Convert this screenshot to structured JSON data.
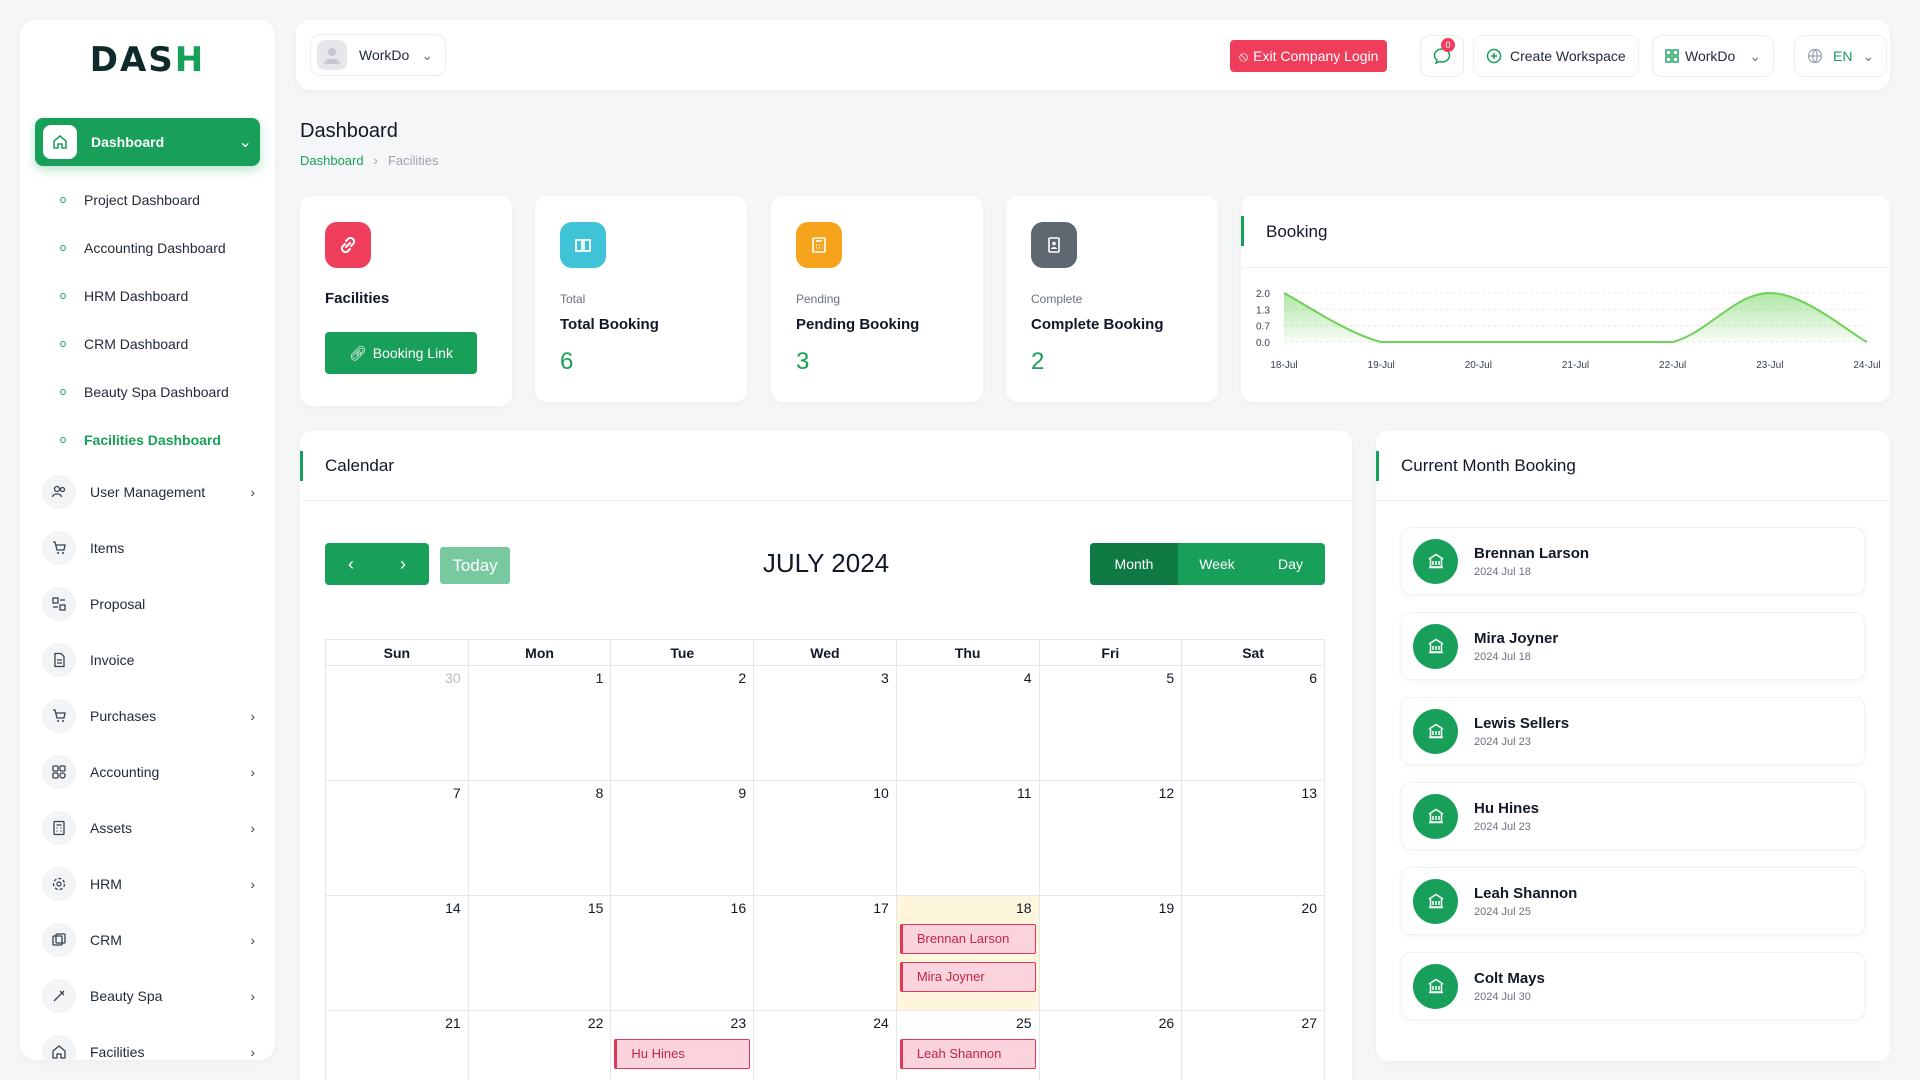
{
  "brand": {
    "logo_text_a": "DAS",
    "logo_text_b": "H"
  },
  "sidebar": {
    "active": "Dashboard",
    "subitems": [
      "Project Dashboard",
      "Accounting Dashboard",
      "HRM Dashboard",
      "CRM Dashboard",
      "Beauty Spa Dashboard",
      "Facilities Dashboard"
    ],
    "items": [
      "User Management",
      "Items",
      "Proposal",
      "Invoice",
      "Purchases",
      "Accounting",
      "Assets",
      "HRM",
      "CRM",
      "Beauty Spa",
      "Facilities"
    ]
  },
  "topbar": {
    "user": "WorkDo",
    "exit": "Exit Company Login",
    "notif_count": "0",
    "create_ws": "Create Workspace",
    "workspace": "WorkDo",
    "lang": "EN"
  },
  "header": {
    "title": "Dashboard",
    "crumb1": "Dashboard",
    "crumb2": "Facilities"
  },
  "stats": {
    "facilities": {
      "title": "Facilities",
      "button": "Booking Link"
    },
    "total": {
      "sub": "Total",
      "title": "Total Booking",
      "value": "6"
    },
    "pending": {
      "sub": "Pending",
      "title": "Pending Booking",
      "value": "3"
    },
    "complete": {
      "sub": "Complete",
      "title": "Complete Booking",
      "value": "2"
    }
  },
  "booking_chart": {
    "title": "Booking"
  },
  "chart_data": {
    "type": "area",
    "title": "Booking",
    "categories": [
      "18-Jul",
      "19-Jul",
      "20-Jul",
      "21-Jul",
      "22-Jul",
      "23-Jul",
      "24-Jul"
    ],
    "values": [
      2,
      0,
      0,
      0,
      0,
      2,
      0
    ],
    "yticks": [
      "2.0",
      "1.3",
      "0.7",
      "0.0"
    ],
    "ylim": [
      0,
      2
    ],
    "color": "#6fd15a"
  },
  "calendar": {
    "title": "Calendar",
    "today": "Today",
    "month_label": "JULY 2024",
    "views": [
      "Month",
      "Week",
      "Day"
    ],
    "days": [
      "Sun",
      "Mon",
      "Tue",
      "Wed",
      "Thu",
      "Fri",
      "Sat"
    ],
    "weeks": [
      [
        "30",
        "1",
        "2",
        "3",
        "4",
        "5",
        "6"
      ],
      [
        "7",
        "8",
        "9",
        "10",
        "11",
        "12",
        "13"
      ],
      [
        "14",
        "15",
        "16",
        "17",
        "18",
        "19",
        "20"
      ],
      [
        "21",
        "22",
        "23",
        "24",
        "25",
        "26",
        "27"
      ]
    ],
    "events": {
      "18": [
        "Brennan Larson",
        "Mira Joyner"
      ],
      "23": [
        "Hu Hines"
      ],
      "25": [
        "Leah Shannon"
      ]
    }
  },
  "current_month": {
    "title": "Current Month Booking",
    "items": [
      {
        "name": "Brennan Larson",
        "date": "2024 Jul 18"
      },
      {
        "name": "Mira Joyner",
        "date": "2024 Jul 18"
      },
      {
        "name": "Lewis Sellers",
        "date": "2024 Jul 23"
      },
      {
        "name": "Hu Hines",
        "date": "2024 Jul 23"
      },
      {
        "name": "Leah Shannon",
        "date": "2024 Jul 25"
      },
      {
        "name": "Colt Mays",
        "date": "2024 Jul 30"
      }
    ]
  }
}
